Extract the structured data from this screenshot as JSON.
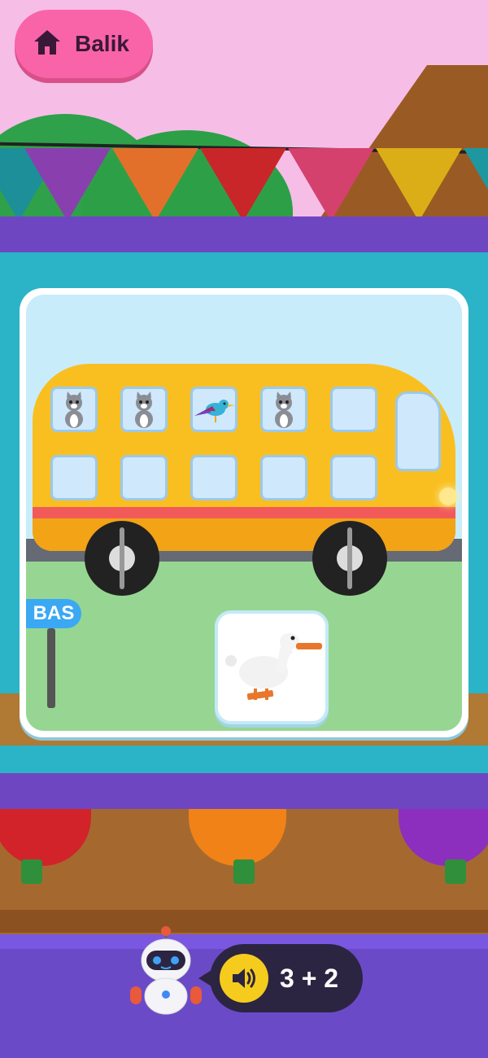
{
  "nav": {
    "back_label": "Balik",
    "back_icon": "home-icon"
  },
  "scene": {
    "bus_stop_sign": "BAS",
    "bus_windows": [
      "cat",
      "cat",
      "bird",
      "cat",
      "empty",
      "empty",
      "empty",
      "empty",
      "empty",
      "empty"
    ],
    "answer_option": "goose"
  },
  "prompt": {
    "speaker_icon": "speaker-icon",
    "equation": "3 + 2"
  },
  "colors": {
    "back_button": "#f964a8",
    "bus": "#f9bf21",
    "speech_bubble": "#2c2541",
    "speaker": "#f5cc1d",
    "teal_board": "#2bb3c8",
    "purple_trim": "#6f46c2"
  }
}
